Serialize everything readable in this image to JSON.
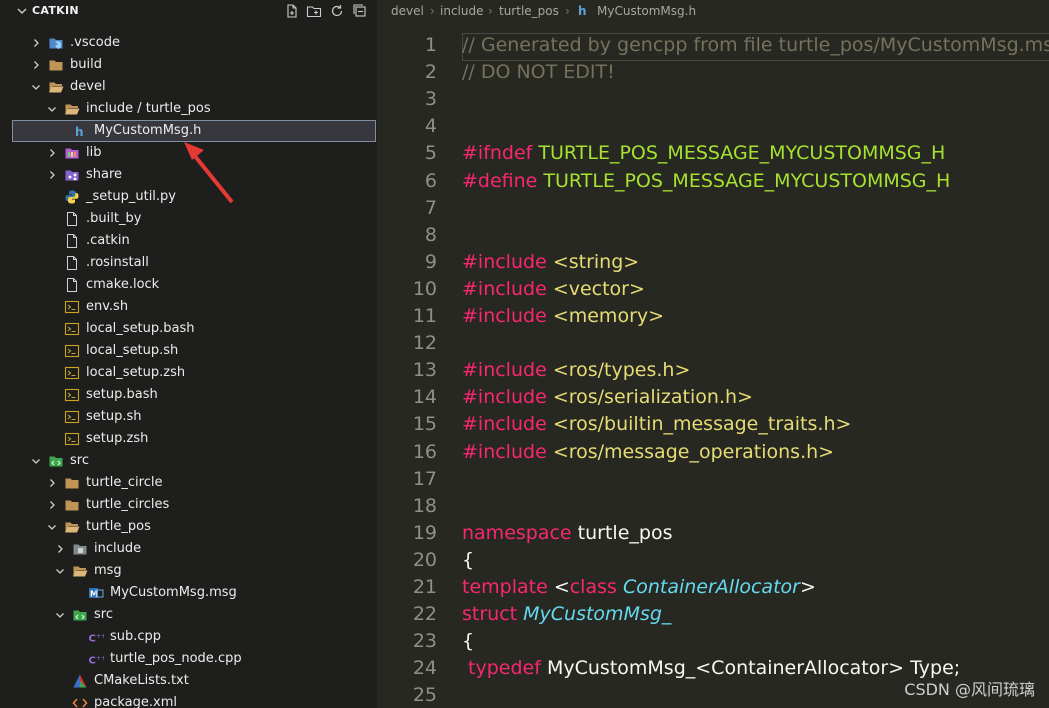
{
  "explorer": {
    "title": "CATKIN",
    "tree": [
      {
        "label": ".vscode",
        "twisty": "closed",
        "icon": "vscode-folder-icon",
        "depth": 1
      },
      {
        "label": "build",
        "twisty": "closed",
        "icon": "folder-icon",
        "depth": 1
      },
      {
        "label": "devel",
        "twisty": "open",
        "icon": "folder-open-icon",
        "depth": 1
      },
      {
        "label": "include / turtle_pos",
        "twisty": "open",
        "icon": "folder-open-icon",
        "depth": 2
      },
      {
        "label": "MyCustomMsg.h",
        "twisty": "none",
        "icon": "c-header-icon",
        "depth": 3,
        "selected": true
      },
      {
        "label": "lib",
        "twisty": "closed",
        "icon": "lib-folder-icon",
        "depth": 2
      },
      {
        "label": "share",
        "twisty": "closed",
        "icon": "share-folder-icon",
        "depth": 2
      },
      {
        "label": "_setup_util.py",
        "twisty": "none",
        "icon": "python-file-icon",
        "depth": 2
      },
      {
        "label": ".built_by",
        "twisty": "none",
        "icon": "file-icon",
        "depth": 2
      },
      {
        "label": ".catkin",
        "twisty": "none",
        "icon": "file-icon",
        "depth": 2
      },
      {
        "label": ".rosinstall",
        "twisty": "none",
        "icon": "file-icon",
        "depth": 2
      },
      {
        "label": "cmake.lock",
        "twisty": "none",
        "icon": "file-icon",
        "depth": 2
      },
      {
        "label": "env.sh",
        "twisty": "none",
        "icon": "shell-file-icon",
        "depth": 2
      },
      {
        "label": "local_setup.bash",
        "twisty": "none",
        "icon": "shell-file-icon",
        "depth": 2
      },
      {
        "label": "local_setup.sh",
        "twisty": "none",
        "icon": "shell-file-icon",
        "depth": 2
      },
      {
        "label": "local_setup.zsh",
        "twisty": "none",
        "icon": "shell-file-icon",
        "depth": 2
      },
      {
        "label": "setup.bash",
        "twisty": "none",
        "icon": "shell-file-icon",
        "depth": 2
      },
      {
        "label": "setup.sh",
        "twisty": "none",
        "icon": "shell-file-icon",
        "depth": 2
      },
      {
        "label": "setup.zsh",
        "twisty": "none",
        "icon": "shell-file-icon",
        "depth": 2
      },
      {
        "label": "src",
        "twisty": "open",
        "icon": "src-folder-icon",
        "depth": 1
      },
      {
        "label": "turtle_circle",
        "twisty": "closed",
        "icon": "folder-icon",
        "depth": 2
      },
      {
        "label": "turtle_circles",
        "twisty": "closed",
        "icon": "folder-icon",
        "depth": 2
      },
      {
        "label": "turtle_pos",
        "twisty": "open",
        "icon": "folder-open-icon",
        "depth": 2
      },
      {
        "label": "include",
        "twisty": "closed",
        "icon": "include-folder-icon",
        "depth": 3
      },
      {
        "label": "msg",
        "twisty": "open",
        "icon": "folder-open-icon",
        "depth": 3
      },
      {
        "label": "MyCustomMsg.msg",
        "twisty": "none",
        "icon": "msg-file-icon",
        "depth": 4
      },
      {
        "label": "src",
        "twisty": "open",
        "icon": "src-folder-icon",
        "depth": 3
      },
      {
        "label": "sub.cpp",
        "twisty": "none",
        "icon": "cpp-file-icon",
        "depth": 4
      },
      {
        "label": "turtle_pos_node.cpp",
        "twisty": "none",
        "icon": "cpp-file-icon",
        "depth": 4
      },
      {
        "label": "CMakeLists.txt",
        "twisty": "none",
        "icon": "cmake-file-icon",
        "depth": 3
      },
      {
        "label": "package.xml",
        "twisty": "none",
        "icon": "xml-file-icon",
        "depth": 3
      }
    ]
  },
  "breadcrumb": {
    "parts": [
      "devel",
      "include",
      "turtle_pos"
    ],
    "file_icon": "h",
    "file": "MyCustomMsg.h"
  },
  "code": [
    [
      [
        "comment",
        "// Generated by gencpp from file turtle_pos/MyCustomMsg.msg"
      ]
    ],
    [
      [
        "comment",
        "// DO NOT EDIT!"
      ]
    ],
    [],
    [],
    [
      [
        "macro-kw",
        "#ifndef "
      ],
      [
        "macro-name",
        "TURTLE_POS_MESSAGE_MYCUSTOMMSG_H"
      ]
    ],
    [
      [
        "macro-kw",
        "#define "
      ],
      [
        "macro-name",
        "TURTLE_POS_MESSAGE_MYCUSTOMMSG_H"
      ]
    ],
    [],
    [],
    [
      [
        "macro-kw",
        "#include "
      ],
      [
        "include-path",
        "<string>"
      ]
    ],
    [
      [
        "macro-kw",
        "#include "
      ],
      [
        "include-path",
        "<vector>"
      ]
    ],
    [
      [
        "macro-kw",
        "#include "
      ],
      [
        "include-path",
        "<memory>"
      ]
    ],
    [],
    [
      [
        "macro-kw",
        "#include "
      ],
      [
        "include-path",
        "<ros/types.h>"
      ]
    ],
    [
      [
        "macro-kw",
        "#include "
      ],
      [
        "include-path",
        "<ros/serialization.h>"
      ]
    ],
    [
      [
        "macro-kw",
        "#include "
      ],
      [
        "include-path",
        "<ros/builtin_message_traits.h>"
      ]
    ],
    [
      [
        "macro-kw",
        "#include "
      ],
      [
        "include-path",
        "<ros/message_operations.h>"
      ]
    ],
    [],
    [],
    [
      [
        "kw",
        "namespace "
      ],
      [
        "plain",
        "turtle_pos"
      ]
    ],
    [
      [
        "plain",
        "{"
      ]
    ],
    [
      [
        "kw",
        "template "
      ],
      [
        "plain",
        "<"
      ],
      [
        "kw",
        "class "
      ],
      [
        "type",
        "ContainerAllocator"
      ],
      [
        "plain",
        ">"
      ]
    ],
    [
      [
        "kw",
        "struct "
      ],
      [
        "type",
        "MyCustomMsg_"
      ]
    ],
    [
      [
        "plain",
        "{"
      ]
    ],
    [
      [
        "plain",
        " "
      ],
      [
        "kw",
        "typedef "
      ],
      [
        "plain",
        "MyCustomMsg_<ContainerAllocator> Type;"
      ]
    ],
    []
  ],
  "line_numbers": [
    "1",
    "2",
    "3",
    "4",
    "5",
    "6",
    "7",
    "8",
    "9",
    "10",
    "11",
    "12",
    "13",
    "14",
    "15",
    "16",
    "17",
    "18",
    "19",
    "20",
    "21",
    "22",
    "23",
    "24",
    "25"
  ],
  "watermark": "CSDN @风间琉璃",
  "colors": {
    "accent": "#a6e22e",
    "keyword": "#f92672",
    "string": "#e6db74",
    "comment": "#75715e",
    "arrow": "#e53935"
  }
}
